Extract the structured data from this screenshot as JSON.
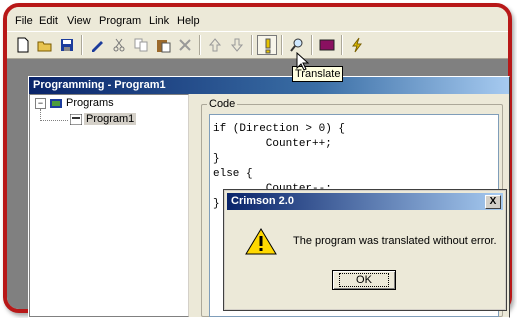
{
  "menu": [
    "File",
    "Edit",
    "View",
    "Program",
    "Link",
    "Help"
  ],
  "toolbar": {
    "buttons": [
      "new-icon",
      "open-icon",
      "save-icon",
      "edit-pencil-icon",
      "cut-icon",
      "copy-icon",
      "paste-icon",
      "delete-icon",
      "move-up-icon",
      "move-down-icon",
      "translate-icon",
      "find-icon",
      "monitor-icon",
      "download-icon"
    ],
    "tooltip": "Translate"
  },
  "child_window": {
    "title": "Programming - Program1",
    "tree": {
      "root": "Programs",
      "child": "Program1"
    },
    "code_label": "Code",
    "code_lines": [
      "if (Direction > 0) {",
      "        Counter++;",
      "}",
      "else {",
      "        Counter--;",
      "}"
    ]
  },
  "dialog": {
    "title": "Crimson 2.0",
    "close": "X",
    "message": "The program was translated without error.",
    "ok_label": "OK"
  },
  "colors": {
    "frame": "#b81818",
    "title_dark": "#0a246a",
    "title_light": "#a6caf0",
    "tooltip_bg": "#ffffe1"
  }
}
